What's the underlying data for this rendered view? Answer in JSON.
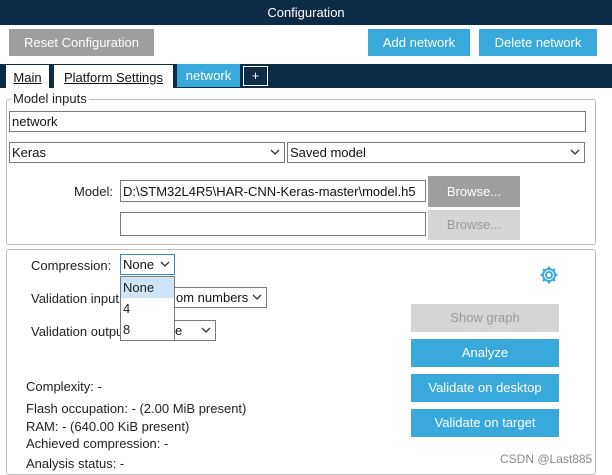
{
  "window": {
    "title": "Configuration"
  },
  "toolbar": {
    "reset_label": "Reset Configuration",
    "add_network_label": "Add network",
    "delete_network_label": "Delete network"
  },
  "tabs": [
    {
      "label": "Main"
    },
    {
      "label": "Platform Settings"
    },
    {
      "label": "network"
    },
    {
      "label": "+"
    }
  ],
  "model_inputs": {
    "legend": "Model inputs",
    "network_name": "network",
    "framework": "Keras",
    "model_type": "Saved model",
    "model_label": "Model:",
    "model_path": "D:\\STM32L4R5\\HAR-CNN-Keras-master\\model.h5",
    "extra_path": "",
    "browse_label": "Browse...",
    "browse2_label": "Browse..."
  },
  "settings": {
    "compression_label": "Compression:",
    "compression_value": "None",
    "compression_options": [
      "None",
      "4",
      "8"
    ],
    "validation_input_label": "Validation input",
    "validation_input_value": "om numbers",
    "validation_output_label": "Validation outpu",
    "validation_output_value": "e"
  },
  "actions": {
    "show_graph": "Show graph",
    "analyze": "Analyze",
    "validate_desktop": "Validate on desktop",
    "validate_target": "Validate on target"
  },
  "stats": {
    "complexity": "Complexity: -",
    "flash": "Flash occupation: - (2.00 MiB present)",
    "ram": "RAM: - (640.00 KiB present)",
    "achieved_compression": "Achieved compression: -",
    "analysis_status": "Analysis status: -"
  },
  "watermark": "CSDN @Last885",
  "colors": {
    "header": "#0e2b46",
    "accent": "#39a9dc",
    "gray_button": "#9e9e9e"
  },
  "icons": [
    "chevron-down-icon",
    "gear-icon"
  ]
}
